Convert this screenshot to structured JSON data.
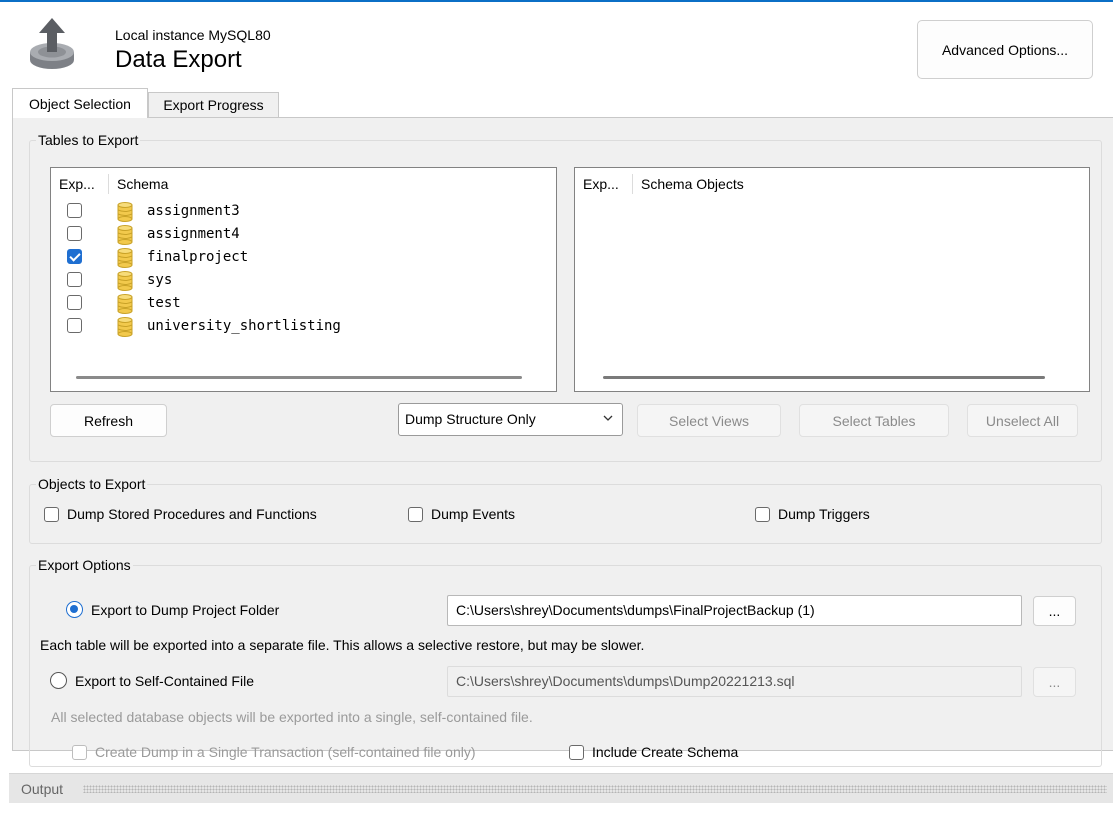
{
  "header": {
    "instance": "Local instance MySQL80",
    "title": "Data Export",
    "advanced_button": "Advanced Options..."
  },
  "tabs": [
    {
      "label": "Object Selection",
      "active": true
    },
    {
      "label": "Export Progress",
      "active": false
    }
  ],
  "tables_group": {
    "legend": "Tables to Export",
    "left_list": {
      "col_export": "Exp...",
      "col_schema": "Schema",
      "rows": [
        {
          "name": "assignment3",
          "checked": false
        },
        {
          "name": "assignment4",
          "checked": false
        },
        {
          "name": "finalproject",
          "checked": true
        },
        {
          "name": "sys",
          "checked": false
        },
        {
          "name": "test",
          "checked": false
        },
        {
          "name": "university_shortlisting",
          "checked": false
        }
      ]
    },
    "right_list": {
      "col_export": "Exp...",
      "col_objects": "Schema Objects"
    },
    "refresh_button": "Refresh",
    "dump_mode": "Dump Structure Only",
    "select_views": "Select Views",
    "select_tables": "Select Tables",
    "unselect_all": "Unselect All"
  },
  "objects_group": {
    "legend": "Objects to Export",
    "procedures": "Dump Stored Procedures and Functions",
    "events": "Dump Events",
    "triggers": "Dump Triggers"
  },
  "options_group": {
    "legend": "Export Options",
    "folder_label": "Export to Dump Project Folder",
    "folder_path": "C:\\Users\\shrey\\Documents\\dumps\\FinalProjectBackup (1)",
    "browse": "...",
    "folder_note": "Each table will be exported into a separate file. This allows a selective restore, but may be slower.",
    "file_label": "Export to Self-Contained File",
    "file_path": "C:\\Users\\shrey\\Documents\\dumps\\Dump20221213.sql",
    "file_note": "All selected database objects will be exported into a single, self-contained file.",
    "single_transaction": "Create Dump in a Single Transaction (self-contained file only)",
    "include_schema": "Include Create Schema"
  },
  "output": {
    "label": "Output"
  },
  "colors": {
    "accent": "#1f6fd1",
    "panel_bg": "#f0f0f0",
    "db_icon": "#f2c94c"
  },
  "icons": [
    "export-database-icon",
    "database-icon",
    "chevron-down-icon"
  ]
}
